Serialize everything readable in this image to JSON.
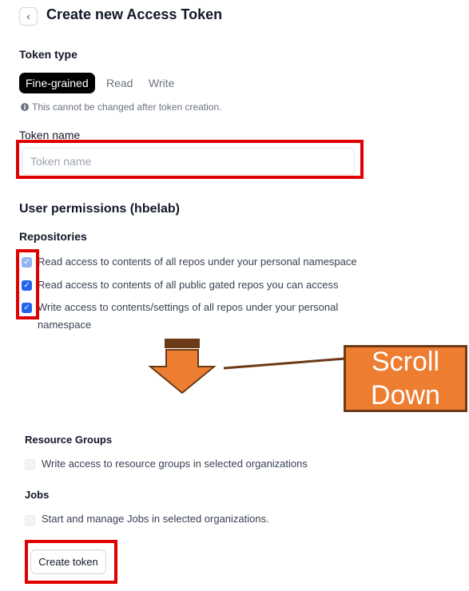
{
  "header": {
    "back_icon": "‹",
    "title": "Create new Access Token"
  },
  "token_type": {
    "label": "Token type",
    "options": [
      "Fine-grained",
      "Read",
      "Write"
    ],
    "selected": "Fine-grained",
    "note": "This cannot be changed after token creation."
  },
  "token_name": {
    "label": "Token name",
    "placeholder": "Token name",
    "value": ""
  },
  "user_permissions": {
    "title": "User permissions (hbelab)",
    "repositories": {
      "label": "Repositories",
      "items": [
        {
          "checked": true,
          "label": "Read access to contents of all repos under your personal namespace"
        },
        {
          "checked": true,
          "label": "Read access to contents of all public gated repos you can access"
        },
        {
          "checked": true,
          "label_line1": "Write access to contents/settings of all repos under your personal",
          "label_line2": "namespace"
        }
      ]
    },
    "resource_groups": {
      "label": "Resource Groups",
      "items": [
        {
          "checked": false,
          "label": "Write access to resource groups in selected organizations"
        }
      ]
    },
    "jobs": {
      "label": "Jobs",
      "items": [
        {
          "checked": false,
          "label": "Start and manage Jobs in selected organizations."
        }
      ]
    }
  },
  "annotation": {
    "scroll_line1": "Scroll",
    "scroll_line2": "Down",
    "arrow_color": "#ed7d31",
    "highlight_color": "#e00000"
  },
  "actions": {
    "create_label": "Create token"
  }
}
